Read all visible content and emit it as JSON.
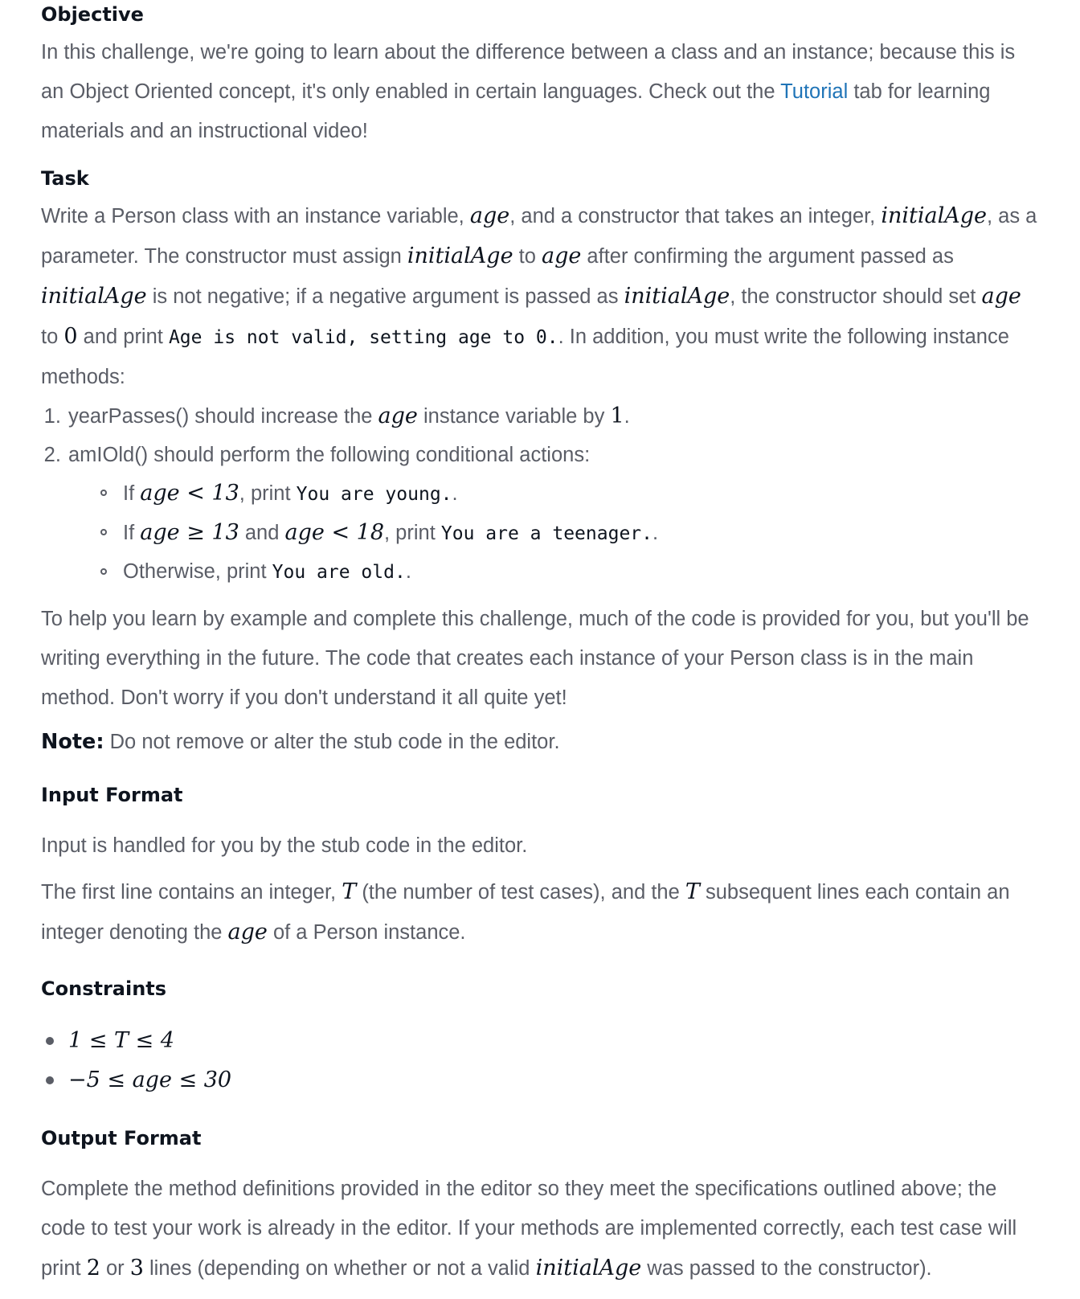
{
  "objective": {
    "heading": "Objective",
    "p1_a": "In this challenge, we're going to learn about the difference between a class and an instance; because this is an Object Oriented concept, it's only enabled in certain languages. Check out the ",
    "p1_link": "Tutorial",
    "p1_b": " tab for learning materials and an instructional video!"
  },
  "task": {
    "heading": "Task",
    "s1": "Write a Person class with an instance variable, ",
    "m_age": "age",
    "s2": ", and a constructor that takes an integer, ",
    "m_initialAge": "initialAge",
    "s3": ", as a parameter. The constructor must assign ",
    "s4": " to ",
    "s5": " after confirming the argument passed as ",
    "s6": " is not negative; if a negative argument is passed as ",
    "s7": ", the constructor should set ",
    "s8": " to ",
    "n_zero": "0",
    "s9": " and print ",
    "code_invalid": "Age is not valid, setting age to 0.",
    "s10": ". In addition, you must write the following instance methods:",
    "methods": [
      {
        "a": "yearPasses() should increase the ",
        "b": " instance variable by ",
        "num": "1",
        "c": "."
      },
      {
        "label": "amIOld() should perform the following conditional actions:",
        "conditions": [
          {
            "pre": "If ",
            "expr": "age < 13",
            "mid": ", print ",
            "code": "You are young.",
            "post": "."
          },
          {
            "pre": "If ",
            "expr1": "age ≥ 13",
            "and": " and ",
            "expr2": "age < 18",
            "mid": ", print ",
            "code": "You are a teenager.",
            "post": "."
          },
          {
            "pre": "Otherwise, print ",
            "code": "You are old.",
            "post": "."
          }
        ]
      }
    ],
    "help": "To help you learn by example and complete this challenge, much of the code is provided for you, but you'll be writing everything in the future. The code that creates each instance of your Person class is in the main method. Don't worry if you don't understand it all quite yet!",
    "note_label": "Note:",
    "note_text": " Do not remove or alter the stub code in the editor."
  },
  "input_format": {
    "heading": "Input Format",
    "p1": "Input is handled for you by the stub code in the editor.",
    "p2_a": "The first line contains an integer, ",
    "m_T": "T",
    "p2_b": " (the number of test cases), and the ",
    "p2_c": " subsequent lines each contain an integer denoting the ",
    "m_age": "age",
    "p2_d": " of a Person instance."
  },
  "constraints": {
    "heading": "Constraints",
    "items": [
      "1 ≤ T ≤ 4",
      "−5 ≤ age ≤ 30"
    ]
  },
  "output_format": {
    "heading": "Output Format",
    "p_a": "Complete the method definitions provided in the editor so they meet the specifications outlined above; the code to test your work is already in the editor. If your methods are implemented correctly, each test case will print ",
    "n2": "2",
    "p_b": " or ",
    "n3": "3",
    "p_c": " lines (depending on whether or not a valid ",
    "m_initialAge": "initialAge",
    "p_d": " was passed to the constructor)."
  }
}
